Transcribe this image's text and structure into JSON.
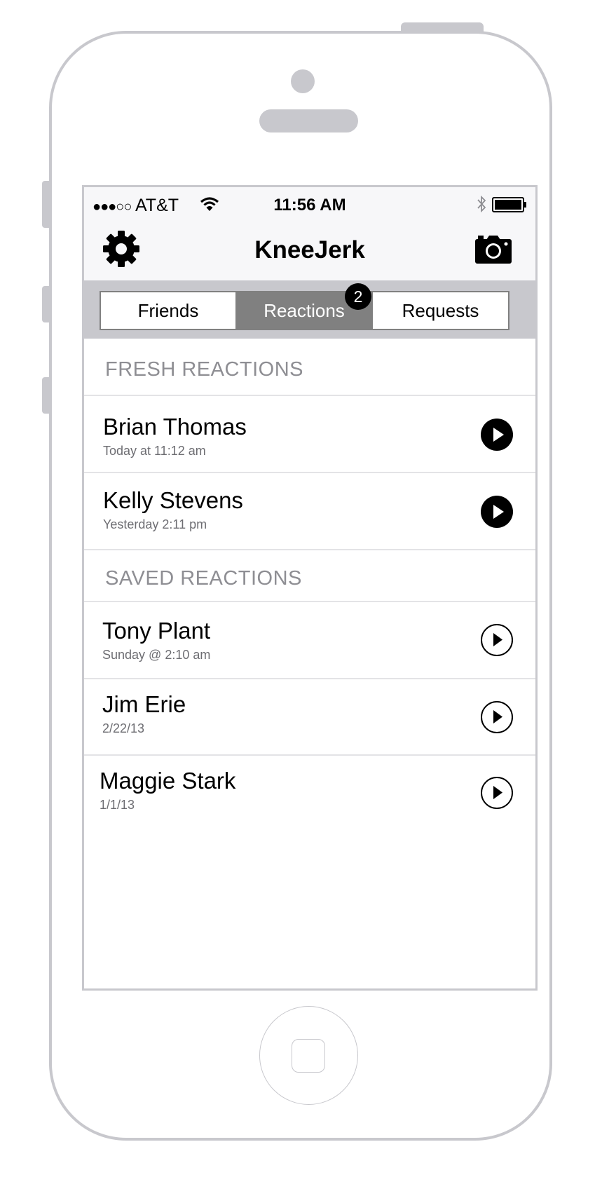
{
  "status_bar": {
    "signal": "●●●○○",
    "carrier": "AT&T",
    "time": "11:56 AM",
    "icons": [
      "wifi-icon",
      "bluetooth-icon",
      "battery-icon"
    ]
  },
  "nav": {
    "title": "KneeJerk",
    "left_icon": "gear-icon",
    "right_icon": "camera-icon"
  },
  "tabs": {
    "items": [
      "Friends",
      "Reactions",
      "Requests"
    ],
    "active": "Reactions",
    "badge": "2"
  },
  "fresh": {
    "header": "FRESH REACTIONS",
    "items": [
      {
        "name": "Brian Thomas",
        "time": "Today at 11:12 am"
      },
      {
        "name": "Kelly Stevens",
        "time": "Yesterday 2:11 pm"
      }
    ]
  },
  "saved": {
    "header": "SAVED REACTIONS",
    "items": [
      {
        "name": "Tony Plant",
        "time": "Sunday @ 2:10 am"
      },
      {
        "name": "Jim Erie",
        "time": "2/22/13"
      },
      {
        "name": "Maggie Stark",
        "time": "1/1/13"
      }
    ]
  },
  "colors": {
    "frame": "#c8c8cd",
    "active_tab": "#808080",
    "section_header": "#8e8e93"
  }
}
